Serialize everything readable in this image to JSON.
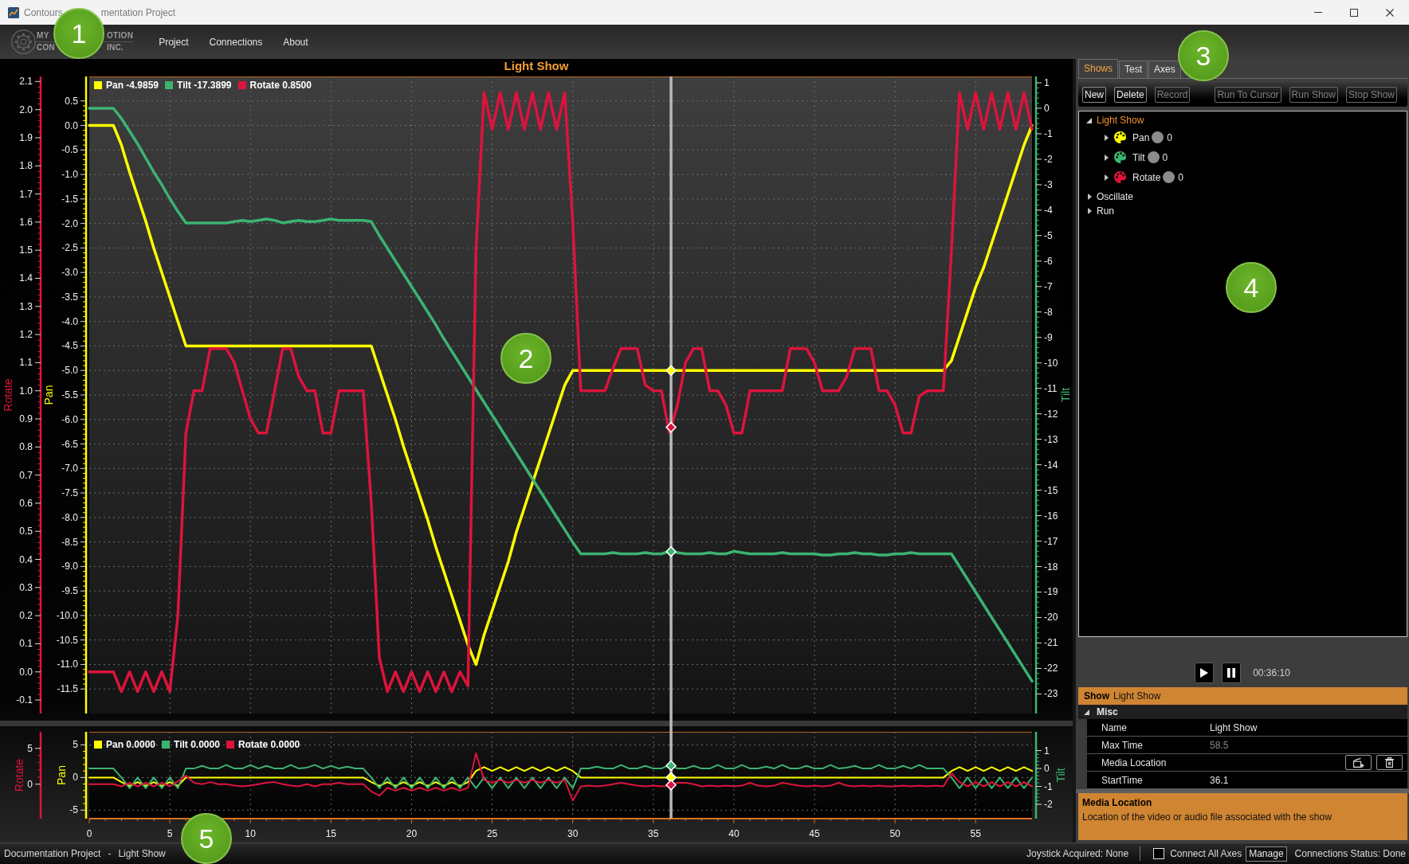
{
  "window": {
    "title_parts": [
      "Contours",
      "mentation Project"
    ]
  },
  "logo": {
    "lines": [
      [
        "MY",
        "OTION"
      ],
      [
        "CON",
        "INC."
      ]
    ]
  },
  "menu": [
    "Project",
    "Connections",
    "About"
  ],
  "chart_panel": {
    "main_chart": {
      "legend_readings": [
        "-4.9859",
        "-17.3899",
        "0.8500"
      ],
      "chart_data": {
        "type": "line",
        "title": "Light Show",
        "grid": true,
        "x": [
          0,
          0.5,
          1,
          1.5,
          2,
          2.5,
          3,
          3.5,
          4,
          4.5,
          5,
          5.5,
          6,
          6.5,
          7,
          7.5,
          8,
          8.5,
          9,
          9.5,
          10,
          10.5,
          11,
          11.5,
          12,
          12.5,
          13,
          13.5,
          14,
          14.5,
          15,
          15.5,
          16,
          16.5,
          17,
          17.5,
          18,
          18.5,
          19,
          19.5,
          20,
          20.5,
          21,
          21.5,
          22,
          22.5,
          23,
          23.5,
          24,
          24.5,
          25,
          25.5,
          26,
          26.5,
          27,
          27.5,
          28,
          28.5,
          29,
          29.5,
          30,
          30.5,
          31,
          31.5,
          32,
          32.5,
          33,
          33.5,
          34,
          34.5,
          35,
          35.5,
          36,
          36.5,
          37,
          37.5,
          38,
          38.5,
          39,
          39.5,
          40,
          40.5,
          41,
          41.5,
          42,
          42.5,
          43,
          43.5,
          44,
          44.5,
          45,
          45.5,
          46,
          46.5,
          47,
          47.5,
          48,
          48.5,
          49,
          49.5,
          50,
          50.5,
          51,
          51.5,
          52,
          52.5,
          53,
          53.5,
          54,
          54.5,
          55,
          55.5,
          56,
          56.5,
          57,
          57.5,
          58,
          58.5
        ],
        "xlim": [
          0,
          58.5
        ],
        "ylabel": "Pan",
        "ylim": [
          -12,
          1
        ],
        "yticks": [
          0.5,
          {
            "value": 0,
            "label": "0.0"
          },
          -0.5,
          {
            "value": -1,
            "label": "-1.0"
          },
          -1.5,
          {
            "value": -2,
            "label": "-2.0"
          },
          -2.5,
          {
            "value": -3,
            "label": "-3.0"
          },
          -3.5,
          {
            "value": -4,
            "label": "-4.0"
          },
          -4.5,
          {
            "value": -5,
            "label": "-5.0"
          },
          -5.5,
          {
            "value": -6,
            "label": "-6.0"
          },
          -6.5,
          {
            "value": -7,
            "label": "-7.0"
          },
          -7.5,
          {
            "value": -8,
            "label": "-8.0"
          },
          -8.5,
          {
            "value": -9,
            "label": "-9.0"
          },
          -9.5,
          {
            "value": -10,
            "label": "-10.0"
          },
          -10.5,
          {
            "value": -11,
            "label": "-11.0"
          },
          -11.5
        ],
        "y2label": "Tilt",
        "y2lim": [
          -23.77,
          1.25
        ],
        "y2ticks": [
          1,
          0,
          -1,
          -2,
          -3,
          -4,
          -5,
          -6,
          -7,
          -8,
          -9,
          -10,
          -11,
          -12,
          -13,
          -14,
          -15,
          -16,
          -17,
          -18,
          -19,
          -20,
          -21,
          -22,
          -23
        ],
        "y3label": "Rotate",
        "y3lim": [
          -0.148,
          2.118
        ],
        "y3ticks": [
          2.1,
          {
            "value": 2,
            "label": "2.0"
          },
          1.9,
          1.8,
          1.7,
          1.6,
          1.5,
          1.4,
          1.3,
          1.2,
          1.1,
          {
            "value": 1,
            "label": "1.0"
          },
          0.9,
          0.8,
          0.7,
          0.6,
          0.5,
          0.4,
          0.3,
          0.2,
          0.1,
          {
            "value": 0,
            "label": "0.0"
          },
          -0.1
        ],
        "series": [
          {
            "name": "Pan",
            "color": "#ffff00",
            "values": [
              0,
              0,
              0,
              0,
              -0.4,
              -0.95,
              -1.45,
              -1.95,
              -2.5,
              -3,
              -3.5,
              -4,
              -4.5,
              -4.5,
              -4.5,
              -4.5,
              -4.5,
              -4.5,
              -4.5,
              -4.5,
              -4.5,
              -4.5,
              -4.5,
              -4.5,
              -4.5,
              -4.5,
              -4.5,
              -4.5,
              -4.5,
              -4.5,
              -4.5,
              -4.5,
              -4.5,
              -4.5,
              -4.5,
              -4.5,
              -5,
              -5.5,
              -6,
              -6.55,
              -7.05,
              -7.55,
              -8.05,
              -8.6,
              -9.1,
              -9.6,
              -10.1,
              -10.6,
              -11,
              -10.4,
              -9.9,
              -9.4,
              -8.9,
              -8.3,
              -7.8,
              -7.3,
              -6.8,
              -6.3,
              -5.8,
              -5.3,
              -5,
              -5,
              -5,
              -5,
              -5,
              -5,
              -5,
              -5,
              -5,
              -5,
              -5,
              -5,
              -5,
              -5,
              -5,
              -5,
              -5,
              -5,
              -5,
              -5,
              -5,
              -5,
              -5,
              -5,
              -5,
              -5,
              -5,
              -5,
              -5,
              -5,
              -5,
              -5,
              -5,
              -5,
              -5,
              -5,
              -5,
              -5,
              -5,
              -5,
              -5,
              -5,
              -5,
              -5,
              -5,
              -5,
              -5,
              -4.8,
              -4.3,
              -3.8,
              -3.3,
              -2.9,
              -2.4,
              -1.9,
              -1.4,
              -0.9,
              -0.4,
              0
            ]
          },
          {
            "name": "Tilt",
            "color": "#3cb371",
            "axis": "y2",
            "values": [
              0,
              0,
              0,
              0,
              -0.4,
              -0.9,
              -1.4,
              -1.95,
              -2.5,
              -3,
              -3.55,
              -4.05,
              -4.5,
              -4.5,
              -4.5,
              -4.5,
              -4.5,
              -4.5,
              -4.45,
              -4.4,
              -4.45,
              -4.4,
              -4.35,
              -4.4,
              -4.5,
              -4.45,
              -4.4,
              -4.45,
              -4.45,
              -4.4,
              -4.35,
              -4.4,
              -4.4,
              -4.4,
              -4.4,
              -4.45,
              -5,
              -5.5,
              -6,
              -6.5,
              -7,
              -7.5,
              -8,
              -8.5,
              -9.05,
              -9.55,
              -10.05,
              -10.55,
              -11.05,
              -11.55,
              -12.05,
              -12.55,
              -13.05,
              -13.55,
              -14.05,
              -14.55,
              -15.05,
              -15.55,
              -16.05,
              -16.55,
              -17.05,
              -17.5,
              -17.5,
              -17.5,
              -17.5,
              -17.45,
              -17.5,
              -17.5,
              -17.5,
              -17.45,
              -17.5,
              -17.5,
              -17.4,
              -17.45,
              -17.5,
              -17.5,
              -17.5,
              -17.45,
              -17.5,
              -17.5,
              -17.4,
              -17.45,
              -17.5,
              -17.5,
              -17.5,
              -17.5,
              -17.45,
              -17.5,
              -17.5,
              -17.5,
              -17.5,
              -17.55,
              -17.55,
              -17.5,
              -17.5,
              -17.45,
              -17.5,
              -17.5,
              -17.55,
              -17.55,
              -17.5,
              -17.5,
              -17.45,
              -17.5,
              -17.5,
              -17.5,
              -17.5,
              -17.5,
              -18,
              -18.5,
              -19,
              -19.5,
              -20,
              -20.5,
              -21,
              -21.5,
              -22,
              -22.5
            ]
          },
          {
            "name": "Rotate",
            "color": "#dc143c",
            "axis": "y3",
            "values": [
              0,
              0,
              0,
              0,
              -0.07,
              0,
              -0.07,
              0,
              -0.07,
              0,
              -0.07,
              0.2,
              0.85,
              1,
              1,
              1.15,
              1.15,
              1.15,
              1.1,
              1,
              0.9,
              0.85,
              0.85,
              1,
              1.15,
              1.15,
              1.05,
              1,
              1,
              0.85,
              0.85,
              1,
              1,
              1,
              1,
              0.6,
              0.05,
              -0.07,
              0,
              -0.07,
              0,
              -0.07,
              0,
              -0.07,
              0,
              -0.07,
              0,
              -0.05,
              1.5,
              2.06,
              1.93,
              2.06,
              1.93,
              2.06,
              1.93,
              2.06,
              1.93,
              2.06,
              1.93,
              2.06,
              1.6,
              1,
              1,
              1,
              1,
              1.08,
              1.15,
              1.15,
              1.15,
              1.02,
              1,
              1,
              0.85,
              0.95,
              1.1,
              1.15,
              1.15,
              1,
              1,
              0.95,
              0.85,
              0.85,
              1,
              1,
              1,
              1,
              1,
              1.15,
              1.15,
              1.15,
              1.1,
              1,
              1,
              1,
              1.05,
              1.15,
              1.15,
              1.15,
              1,
              1,
              0.95,
              0.85,
              0.85,
              0.98,
              1,
              1,
              1,
              1.5,
              2.06,
              1.93,
              2.06,
              1.93,
              2.06,
              1.93,
              2.06,
              1.93,
              2.06,
              1.93
            ]
          }
        ],
        "ref_lines": [
          {
            "axis": "x",
            "value": 36.1
          }
        ]
      }
    },
    "overview_chart": {
      "legend_readings": [
        "0.0000",
        "0.0000",
        "0.0000"
      ],
      "chart_data": {
        "type": "line",
        "grid": true,
        "x": [
          0,
          0.5,
          1,
          1.5,
          2,
          2.5,
          3,
          3.5,
          4,
          4.5,
          5,
          5.5,
          6,
          6.5,
          7,
          7.5,
          8,
          8.5,
          9,
          9.5,
          10,
          10.5,
          11,
          11.5,
          12,
          12.5,
          13,
          13.5,
          14,
          14.5,
          15,
          15.5,
          16,
          16.5,
          17,
          17.5,
          18,
          18.5,
          19,
          19.5,
          20,
          20.5,
          21,
          21.5,
          22,
          22.5,
          23,
          23.5,
          24,
          24.5,
          25,
          25.5,
          26,
          26.5,
          27,
          27.5,
          28,
          28.5,
          29,
          29.5,
          30,
          30.5,
          31,
          31.5,
          32,
          32.5,
          33,
          33.5,
          34,
          34.5,
          35,
          35.5,
          36,
          36.5,
          37,
          37.5,
          38,
          38.5,
          39,
          39.5,
          40,
          40.5,
          41,
          41.5,
          42,
          42.5,
          43,
          43.5,
          44,
          44.5,
          45,
          45.5,
          46,
          46.5,
          47,
          47.5,
          48,
          48.5,
          49,
          49.5,
          50,
          50.5,
          51,
          51.5,
          52,
          52.5,
          53,
          53.5,
          54,
          54.5,
          55,
          55.5,
          56,
          56.5,
          57,
          57.5,
          58,
          58.5
        ],
        "xlim": [
          0,
          58.5
        ],
        "xticks": [
          0,
          5,
          10,
          15,
          20,
          25,
          30,
          35,
          40,
          45,
          50,
          55
        ],
        "ylabel": "Pan",
        "ylim": [
          -6.3,
          7
        ],
        "yticks": [
          5,
          0,
          -5
        ],
        "y2label": "Tilt",
        "y2lim": [
          -2.8,
          2.05
        ],
        "y2ticks": [
          1,
          0,
          -1,
          -2
        ],
        "y3label": "Rotate",
        "y3lim": [
          -4.8,
          7.3
        ],
        "y3ticks": [
          5,
          0
        ],
        "series": [
          {
            "name": "Pan",
            "color": "#ffff00",
            "values": [
              0,
              0,
              0,
              0,
              -0.7,
              -1.3,
              -0.7,
              -1.3,
              -0.7,
              -1.3,
              -0.7,
              -1.3,
              0,
              0,
              0,
              0,
              0,
              0,
              0,
              0,
              0,
              0,
              0,
              0,
              0,
              0,
              0,
              0,
              0,
              0,
              0,
              0,
              0,
              0,
              0,
              -0.7,
              -1.3,
              -0.7,
              -1.3,
              -0.7,
              -1.3,
              -0.7,
              -1.3,
              -0.7,
              -1.3,
              -0.7,
              -1.3,
              -0.7,
              1,
              1.6,
              1,
              1.6,
              1,
              1.6,
              1,
              1.6,
              1,
              1.6,
              1,
              1.6,
              1,
              0,
              0,
              0,
              0,
              0,
              0,
              0,
              0,
              0,
              0,
              0,
              0,
              0,
              0,
              0,
              0,
              0,
              0,
              0,
              0,
              0,
              0,
              0,
              0,
              0,
              0,
              0,
              0,
              0,
              0,
              0,
              0,
              0,
              0,
              0,
              0,
              0,
              0,
              0,
              0,
              0,
              0,
              0,
              0,
              0,
              0,
              1,
              1.6,
              1,
              1.6,
              1,
              1.6,
              1,
              1.6,
              1,
              1.6,
              1
            ]
          },
          {
            "name": "Tilt",
            "color": "#3cb371",
            "axis": "y2",
            "values": [
              0,
              0,
              0,
              0,
              -0.5,
              -1.1,
              -0.5,
              -1.1,
              -0.5,
              -1.1,
              -0.5,
              -1.1,
              0,
              0,
              0.15,
              0,
              0,
              0.2,
              0,
              0,
              0.2,
              0,
              0.15,
              0,
              0,
              0.2,
              0,
              0.05,
              0.2,
              0,
              0.15,
              0,
              0.1,
              0,
              0,
              -0.5,
              -1.1,
              -0.5,
              -1.1,
              -0.5,
              -1.1,
              -0.5,
              -1.1,
              -0.5,
              -1.1,
              -0.5,
              -1.1,
              -0.5,
              -1.1,
              -0.5,
              -1.1,
              -0.5,
              -1.1,
              -0.5,
              -1.1,
              -0.5,
              -1.1,
              -0.5,
              -1.1,
              -0.5,
              -1.1,
              0,
              0,
              0.1,
              0,
              0,
              0.2,
              0,
              0,
              0.15,
              0,
              0,
              0.2,
              0,
              0,
              0.15,
              0,
              0,
              0.2,
              0,
              0,
              0.2,
              0,
              0,
              0.1,
              0,
              0.2,
              0,
              0,
              0.15,
              0,
              0,
              0.2,
              0,
              0.05,
              0.15,
              0,
              0,
              0.2,
              0,
              0,
              0.15,
              0,
              0.2,
              0,
              0,
              0,
              -0.5,
              -1.1,
              -0.5,
              -1.1,
              -0.5,
              -1.1,
              -0.5,
              -1.1,
              -0.5,
              -1.1,
              -0.5
            ]
          },
          {
            "name": "Rotate",
            "color": "#dc143c",
            "axis": "y3",
            "values": [
              0,
              0,
              0,
              0,
              -0.3,
              0.2,
              -0.3,
              0.2,
              -0.3,
              0.2,
              -0.3,
              0.4,
              1.2,
              0.2,
              0,
              0.3,
              0,
              0,
              -0.2,
              -0.3,
              -0.2,
              0,
              0.2,
              0.3,
              0,
              -0.2,
              -0.3,
              0,
              -0.3,
              0,
              0,
              0.2,
              0,
              0,
              0,
              -1,
              -1.6,
              -0.5,
              -0.9,
              -0.5,
              -0.9,
              -0.5,
              -0.9,
              -0.5,
              -0.9,
              -0.5,
              -0.9,
              -0.5,
              4.3,
              0.6,
              0.2,
              0.6,
              0.2,
              0.6,
              0.2,
              0.6,
              0.2,
              0.6,
              0.2,
              0.6,
              -2.3,
              -0.3,
              -0.2,
              -0.3,
              -0.2,
              0,
              0.2,
              0,
              -0.2,
              -0.3,
              -0.2,
              -0.3,
              -0.2,
              0.2,
              0.2,
              0,
              -0.3,
              -0.2,
              -0.3,
              -0.2,
              -0.3,
              -0.2,
              0.2,
              -0.2,
              -0.3,
              -0.2,
              0.2,
              0,
              -0.2,
              -0.3,
              -0.2,
              -0.3,
              -0.2,
              0.2,
              -0.2,
              -0.3,
              -0.2,
              -0.3,
              -0.2,
              -0.3,
              -0.3,
              -0.2,
              -0.3,
              -0.2,
              -0.3,
              -0.2,
              -0.3,
              1.5,
              0.3,
              -0.3,
              0.3,
              -0.3,
              0.3,
              -0.3,
              0.3,
              -0.3,
              0.3,
              -0.3
            ]
          }
        ],
        "ref_lines": [
          {
            "axis": "x",
            "value": 36.1
          }
        ]
      }
    }
  },
  "side_panel": {
    "tabs": [
      {
        "label": "Shows",
        "selected": true
      },
      {
        "label": "Test",
        "selected": false
      },
      {
        "label": "Axes",
        "selected": false
      }
    ],
    "toolbar": {
      "left_buttons": [
        {
          "label": "New",
          "disabled": false
        },
        {
          "label": "Delete",
          "disabled": false
        },
        {
          "label": "Record",
          "disabled": true
        }
      ],
      "right_buttons": [
        {
          "label": "Run To Cursor",
          "disabled": true
        },
        {
          "label": "Run Show",
          "disabled": true
        },
        {
          "label": "Stop Show",
          "disabled": true
        }
      ]
    },
    "tree": [
      {
        "label": "Light Show",
        "selected": true,
        "expanded": true,
        "children": [
          {
            "label": "Pan",
            "color": "#ffff00",
            "dot_value": "0",
            "selected": false,
            "expanded": false
          },
          {
            "label": "Tilt",
            "color": "#3cb371",
            "dot_value": "0",
            "selected": false,
            "expanded": false
          },
          {
            "label": "Rotate",
            "color": "#dc143c",
            "dot_value": "0",
            "selected": false,
            "expanded": false
          }
        ]
      },
      {
        "label": "Oscillate",
        "selected": false,
        "expanded": false
      },
      {
        "label": "Run",
        "selected": false,
        "expanded": false
      }
    ],
    "playback": {
      "buttons": [
        {
          "kind": "play"
        },
        {
          "kind": "pause"
        }
      ],
      "time": "00:36:10"
    },
    "property_grid": {
      "header": {
        "type": "Show",
        "name": "Light Show"
      },
      "categories": [
        {
          "label": "Misc",
          "expanded": true,
          "rows": [
            {
              "label": "Name",
              "kind": "text",
              "value": "Light Show",
              "readonly": false
            },
            {
              "label": "Max Time",
              "kind": "text",
              "value": "58.5",
              "readonly": true
            },
            {
              "label": "Media Location",
              "kind": "media"
            },
            {
              "label": "StartTime",
              "kind": "text",
              "value": "36.1",
              "readonly": false
            }
          ]
        }
      ],
      "description": {
        "title": "Media Location",
        "text": "Location of the video or audio file associated with the show"
      }
    }
  },
  "status_bar": {
    "project": "Documentation Project",
    "separator": "-",
    "show": "Light Show",
    "joystick": "Joystick Acquired: None",
    "connect_all": {
      "label": "Connect All Axes",
      "checked": false
    },
    "manage_button": "Manage",
    "connection_status": "Connections Status: Done"
  },
  "callouts": [
    "1",
    "2",
    "3",
    "4",
    "5"
  ]
}
